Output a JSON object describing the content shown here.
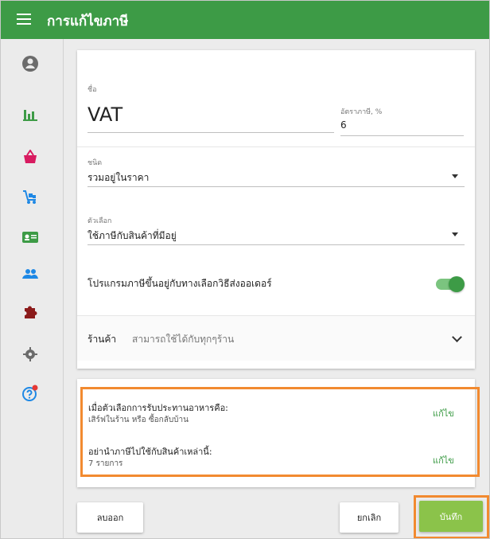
{
  "appbar": {
    "title": "การแก้ไขภาษี"
  },
  "sidebar": {
    "items": [
      {
        "icon": "account-icon",
        "color": "#6b6b6b"
      },
      {
        "icon": "bar-chart-icon",
        "color": "#3d9b46"
      },
      {
        "icon": "basket-icon",
        "color": "#d81b60"
      },
      {
        "icon": "cart-loading-icon",
        "color": "#1e88e5"
      },
      {
        "icon": "id-card-icon",
        "color": "#3d9b46"
      },
      {
        "icon": "people-icon",
        "color": "#1e88e5"
      },
      {
        "icon": "puzzle-icon",
        "color": "#8b1b1b"
      },
      {
        "icon": "gear-icon",
        "color": "#6b6b6b"
      },
      {
        "icon": "help-icon",
        "color": "#1e88e5"
      }
    ]
  },
  "tax": {
    "name_label": "ชื่อ",
    "name_value": "VAT",
    "rate_label": "อัตราภาษี, %",
    "rate_value": "6",
    "type_label": "ชนิด",
    "type_value": "รวมอยู่ในราคา",
    "option_label": "ตัวเลือก",
    "option_value": "ใช้ภาษีกับสินค้าที่มีอยู่",
    "toggle_label": "โปรแกรมภาษีขึ้นอยู่กับทางเลือกวิธีส่งออเดอร์",
    "toggle_on": true,
    "store_label": "ร้านค้า",
    "store_value": "สามารถใช้ได้กับทุกๆร้าน"
  },
  "conditions": {
    "dining_title": "เมื่อตัวเลือกการรับประทานอาหารคือ:",
    "dining_value": "เสิร์ฟในร้าน หรือ ซื้อกลับบ้าน",
    "dining_edit": "แก้ไข",
    "items_title": "อย่านำภาษีไปใช้กับสินค้าเหล่านี้:",
    "items_value": "7 รายการ",
    "items_edit": "แก้ไข"
  },
  "actions": {
    "delete": "ลบออก",
    "cancel": "ยกเลิก",
    "save": "บันทึก"
  },
  "colors": {
    "primary": "#3d9b46",
    "save": "#8bc34a",
    "highlight": "#f28a30"
  }
}
